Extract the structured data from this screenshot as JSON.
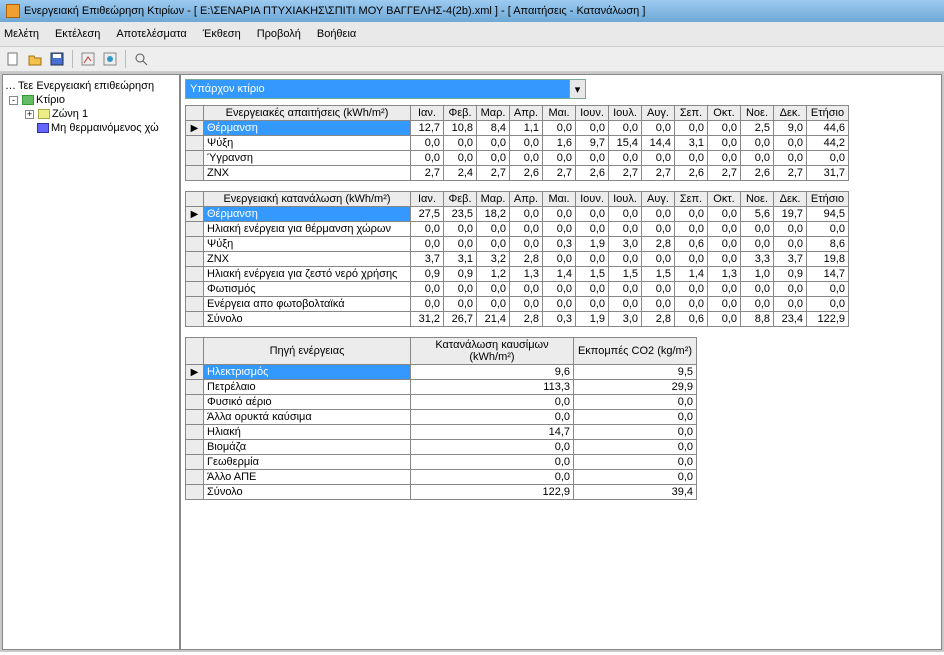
{
  "title": "Ενεργειακή Επιθεώρηση Κτιρίων - [ E:\\ΣΕΝΑΡΙΑ ΠΤΥΧΙΑΚΗΣ\\ΣΠΙΤΙ ΜΟΥ ΒΑΓΓΕΛΗΣ-4(2b).xml ] - [ Απαιτήσεις - Κατανάλωση ]",
  "menu": {
    "m0": "Μελέτη",
    "m1": "Εκτέλεση",
    "m2": "Αποτελέσματα",
    "m3": "Έκθεση",
    "m4": "Προβολή",
    "m5": "Βοήθεια"
  },
  "tree": {
    "root": "Τεε Ενεργειακή επιθεώρηση",
    "building": "Κτίριο",
    "zone": "Ζώνη 1",
    "unheated": "Μη θερμαινόμενος χώ"
  },
  "combo": "Υπάρχον κτίριο",
  "months": [
    "Ιαν.",
    "Φεβ.",
    "Μαρ.",
    "Απρ.",
    "Μαι.",
    "Ιουν.",
    "Ιουλ.",
    "Αυγ.",
    "Σεπ.",
    "Οκτ.",
    "Νοε.",
    "Δεκ."
  ],
  "col_annual": "Ετήσιο",
  "t1": {
    "header": "Ενεργειακές απαιτήσεις (kWh/m²)",
    "rows": [
      {
        "label": "Θέρμανση",
        "v": [
          "12,7",
          "10,8",
          "8,4",
          "1,1",
          "0,0",
          "0,0",
          "0,0",
          "0,0",
          "0,0",
          "0,0",
          "2,5",
          "9,0",
          "44,6"
        ],
        "sel": true
      },
      {
        "label": "Ψύξη",
        "v": [
          "0,0",
          "0,0",
          "0,0",
          "0,0",
          "1,6",
          "9,7",
          "15,4",
          "14,4",
          "3,1",
          "0,0",
          "0,0",
          "0,0",
          "44,2"
        ]
      },
      {
        "label": "Ύγρανση",
        "v": [
          "0,0",
          "0,0",
          "0,0",
          "0,0",
          "0,0",
          "0,0",
          "0,0",
          "0,0",
          "0,0",
          "0,0",
          "0,0",
          "0,0",
          "0,0"
        ]
      },
      {
        "label": "ZNX",
        "v": [
          "2,7",
          "2,4",
          "2,7",
          "2,6",
          "2,7",
          "2,6",
          "2,7",
          "2,7",
          "2,6",
          "2,7",
          "2,6",
          "2,7",
          "31,7"
        ]
      }
    ]
  },
  "t2": {
    "header": "Ενεργειακή κατανάλωση (kWh/m²)",
    "rows": [
      {
        "label": "Θέρμανση",
        "v": [
          "27,5",
          "23,5",
          "18,2",
          "0,0",
          "0,0",
          "0,0",
          "0,0",
          "0,0",
          "0,0",
          "0,0",
          "5,6",
          "19,7",
          "94,5"
        ],
        "sel": true
      },
      {
        "label": "Ηλιακή ενέργεια για θέρμανση χώρων",
        "v": [
          "0,0",
          "0,0",
          "0,0",
          "0,0",
          "0,0",
          "0,0",
          "0,0",
          "0,0",
          "0,0",
          "0,0",
          "0,0",
          "0,0",
          "0,0"
        ]
      },
      {
        "label": "Ψύξη",
        "v": [
          "0,0",
          "0,0",
          "0,0",
          "0,0",
          "0,3",
          "1,9",
          "3,0",
          "2,8",
          "0,6",
          "0,0",
          "0,0",
          "0,0",
          "8,6"
        ]
      },
      {
        "label": "ZNX",
        "v": [
          "3,7",
          "3,1",
          "3,2",
          "2,8",
          "0,0",
          "0,0",
          "0,0",
          "0,0",
          "0,0",
          "0,0",
          "3,3",
          "3,7",
          "19,8"
        ]
      },
      {
        "label": "Ηλιακή ενέργεια για ζεστό νερό χρήσης",
        "v": [
          "0,9",
          "0,9",
          "1,2",
          "1,3",
          "1,4",
          "1,5",
          "1,5",
          "1,5",
          "1,4",
          "1,3",
          "1,0",
          "0,9",
          "14,7"
        ]
      },
      {
        "label": "Φωτισμός",
        "v": [
          "0,0",
          "0,0",
          "0,0",
          "0,0",
          "0,0",
          "0,0",
          "0,0",
          "0,0",
          "0,0",
          "0,0",
          "0,0",
          "0,0",
          "0,0"
        ]
      },
      {
        "label": "Ενέργεια απο φωτοβολταϊκά",
        "v": [
          "0,0",
          "0,0",
          "0,0",
          "0,0",
          "0,0",
          "0,0",
          "0,0",
          "0,0",
          "0,0",
          "0,0",
          "0,0",
          "0,0",
          "0,0"
        ]
      },
      {
        "label": "Σύνολο",
        "v": [
          "31,2",
          "26,7",
          "21,4",
          "2,8",
          "0,3",
          "1,9",
          "3,0",
          "2,8",
          "0,6",
          "0,0",
          "8,8",
          "23,4",
          "122,9"
        ]
      }
    ]
  },
  "t3": {
    "header": "Πηγή ενέργειας",
    "c2": "Κατανάλωση καυσίμων (kWh/m²)",
    "c3": "Εκπομπές CO2 (kg/m²)",
    "rows": [
      {
        "label": "Ηλεκτρισμός",
        "a": "9,6",
        "b": "9,5",
        "sel": true
      },
      {
        "label": "Πετρέλαιο",
        "a": "113,3",
        "b": "29,9"
      },
      {
        "label": "Φυσικό αέριο",
        "a": "0,0",
        "b": "0,0"
      },
      {
        "label": "Άλλα ορυκτά καύσιμα",
        "a": "0,0",
        "b": "0,0"
      },
      {
        "label": "Ηλιακή",
        "a": "14,7",
        "b": "0,0"
      },
      {
        "label": "Βιομάζα",
        "a": "0,0",
        "b": "0,0"
      },
      {
        "label": "Γεωθερμία",
        "a": "0,0",
        "b": "0,0"
      },
      {
        "label": "Άλλο ΑΠΕ",
        "a": "0,0",
        "b": "0,0"
      },
      {
        "label": "Σύνολο",
        "a": "122,9",
        "b": "39,4"
      }
    ]
  },
  "chart_data": [
    {
      "type": "table",
      "title": "Ενεργειακές απαιτήσεις (kWh/m²)",
      "categories": [
        "Ιαν.",
        "Φεβ.",
        "Μαρ.",
        "Απρ.",
        "Μαι.",
        "Ιουν.",
        "Ιουλ.",
        "Αυγ.",
        "Σεπ.",
        "Οκτ.",
        "Νοε.",
        "Δεκ.",
        "Ετήσιο"
      ],
      "series": [
        {
          "name": "Θέρμανση",
          "values": [
            12.7,
            10.8,
            8.4,
            1.1,
            0.0,
            0.0,
            0.0,
            0.0,
            0.0,
            0.0,
            2.5,
            9.0,
            44.6
          ]
        },
        {
          "name": "Ψύξη",
          "values": [
            0.0,
            0.0,
            0.0,
            0.0,
            1.6,
            9.7,
            15.4,
            14.4,
            3.1,
            0.0,
            0.0,
            0.0,
            44.2
          ]
        },
        {
          "name": "Ύγρανση",
          "values": [
            0.0,
            0.0,
            0.0,
            0.0,
            0.0,
            0.0,
            0.0,
            0.0,
            0.0,
            0.0,
            0.0,
            0.0,
            0.0
          ]
        },
        {
          "name": "ZNX",
          "values": [
            2.7,
            2.4,
            2.7,
            2.6,
            2.7,
            2.6,
            2.7,
            2.7,
            2.6,
            2.7,
            2.6,
            2.7,
            31.7
          ]
        }
      ]
    },
    {
      "type": "table",
      "title": "Ενεργειακή κατανάλωση (kWh/m²)",
      "categories": [
        "Ιαν.",
        "Φεβ.",
        "Μαρ.",
        "Απρ.",
        "Μαι.",
        "Ιουν.",
        "Ιουλ.",
        "Αυγ.",
        "Σεπ.",
        "Οκτ.",
        "Νοε.",
        "Δεκ.",
        "Ετήσιο"
      ],
      "series": [
        {
          "name": "Θέρμανση",
          "values": [
            27.5,
            23.5,
            18.2,
            0.0,
            0.0,
            0.0,
            0.0,
            0.0,
            0.0,
            0.0,
            5.6,
            19.7,
            94.5
          ]
        },
        {
          "name": "Ηλιακή ενέργεια για θέρμανση χώρων",
          "values": [
            0.0,
            0.0,
            0.0,
            0.0,
            0.0,
            0.0,
            0.0,
            0.0,
            0.0,
            0.0,
            0.0,
            0.0,
            0.0
          ]
        },
        {
          "name": "Ψύξη",
          "values": [
            0.0,
            0.0,
            0.0,
            0.0,
            0.3,
            1.9,
            3.0,
            2.8,
            0.6,
            0.0,
            0.0,
            0.0,
            8.6
          ]
        },
        {
          "name": "ZNX",
          "values": [
            3.7,
            3.1,
            3.2,
            2.8,
            0.0,
            0.0,
            0.0,
            0.0,
            0.0,
            0.0,
            3.3,
            3.7,
            19.8
          ]
        },
        {
          "name": "Ηλιακή ενέργεια για ζεστό νερό χρήσης",
          "values": [
            0.9,
            0.9,
            1.2,
            1.3,
            1.4,
            1.5,
            1.5,
            1.5,
            1.4,
            1.3,
            1.0,
            0.9,
            14.7
          ]
        },
        {
          "name": "Φωτισμός",
          "values": [
            0.0,
            0.0,
            0.0,
            0.0,
            0.0,
            0.0,
            0.0,
            0.0,
            0.0,
            0.0,
            0.0,
            0.0,
            0.0
          ]
        },
        {
          "name": "Ενέργεια απο φωτοβολταϊκά",
          "values": [
            0.0,
            0.0,
            0.0,
            0.0,
            0.0,
            0.0,
            0.0,
            0.0,
            0.0,
            0.0,
            0.0,
            0.0,
            0.0
          ]
        },
        {
          "name": "Σύνολο",
          "values": [
            31.2,
            26.7,
            21.4,
            2.8,
            0.3,
            1.9,
            3.0,
            2.8,
            0.6,
            0.0,
            8.8,
            23.4,
            122.9
          ]
        }
      ]
    },
    {
      "type": "table",
      "title": "Πηγή ενέργειας",
      "columns": [
        "Κατανάλωση καυσίμων (kWh/m²)",
        "Εκπομπές CO2 (kg/m²)"
      ],
      "series": [
        {
          "name": "Ηλεκτρισμός",
          "values": [
            9.6,
            9.5
          ]
        },
        {
          "name": "Πετρέλαιο",
          "values": [
            113.3,
            29.9
          ]
        },
        {
          "name": "Φυσικό αέριο",
          "values": [
            0.0,
            0.0
          ]
        },
        {
          "name": "Άλλα ορυκτά καύσιμα",
          "values": [
            0.0,
            0.0
          ]
        },
        {
          "name": "Ηλιακή",
          "values": [
            14.7,
            0.0
          ]
        },
        {
          "name": "Βιομάζα",
          "values": [
            0.0,
            0.0
          ]
        },
        {
          "name": "Γεωθερμία",
          "values": [
            0.0,
            0.0
          ]
        },
        {
          "name": "Άλλο ΑΠΕ",
          "values": [
            0.0,
            0.0
          ]
        },
        {
          "name": "Σύνολο",
          "values": [
            122.9,
            39.4
          ]
        }
      ]
    }
  ]
}
